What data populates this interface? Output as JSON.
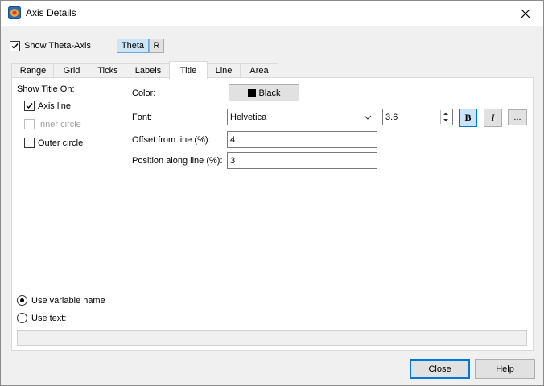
{
  "window": {
    "title": "Axis Details"
  },
  "header": {
    "show_axis_label": "Show Theta-Axis",
    "show_axis_checked": true,
    "axis_buttons": [
      "Theta",
      "R"
    ],
    "active_axis": "Theta"
  },
  "tabs": [
    "Range",
    "Grid",
    "Ticks",
    "Labels",
    "Title",
    "Line",
    "Area"
  ],
  "active_tab": "Title",
  "title_tab": {
    "show_title_on_label": "Show Title On:",
    "options": [
      {
        "label": "Axis line",
        "checked": true,
        "enabled": true
      },
      {
        "label": "Inner circle",
        "checked": false,
        "enabled": false
      },
      {
        "label": "Outer circle",
        "checked": false,
        "enabled": true
      }
    ],
    "color_label": "Color:",
    "color_value": "Black",
    "color_hex": "#000000",
    "font_label": "Font:",
    "font_value": "Helvetica",
    "font_size": "3.6",
    "bold_label": "B",
    "bold_active": true,
    "italic_label": "I",
    "more_label": "...",
    "offset_label": "Offset from line (%):",
    "offset_value": "4",
    "position_label": "Position along line (%):",
    "position_value": "3",
    "use_variable_name_label": "Use variable name",
    "use_variable_name_selected": true,
    "use_text_label": "Use text:",
    "use_text_value": ""
  },
  "footer": {
    "close_label": "Close",
    "help_label": "Help"
  },
  "colors": {
    "accent": "#0078d7",
    "selected_bg": "#cce4f7",
    "button_bg": "#e1e1e1"
  }
}
